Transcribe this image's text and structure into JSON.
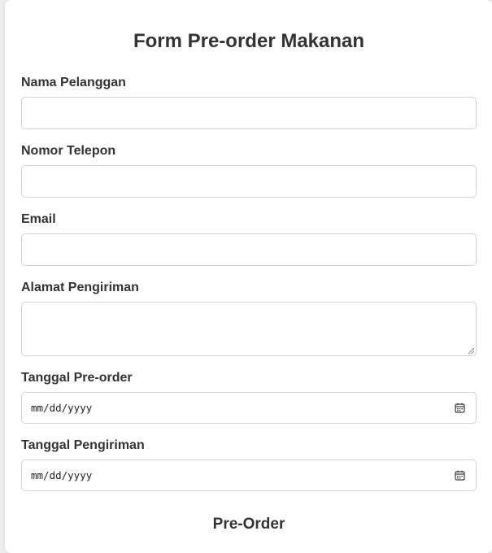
{
  "form": {
    "title": "Form Pre-order Makanan",
    "fields": {
      "nama": {
        "label": "Nama Pelanggan",
        "value": ""
      },
      "telepon": {
        "label": "Nomor Telepon",
        "value": ""
      },
      "email": {
        "label": "Email",
        "value": ""
      },
      "alamat": {
        "label": "Alamat Pengiriman",
        "value": ""
      },
      "tanggal_preorder": {
        "label": "Tanggal Pre-order",
        "value": "mm/dd/yyyy",
        "icon": "calendar-icon"
      },
      "tanggal_pengiriman": {
        "label": "Tanggal Pengiriman",
        "value": "mm/dd/yyyy",
        "icon": "calendar-icon"
      }
    },
    "submit_label": "Pre-Order"
  },
  "colors": {
    "page_background": "#efefef",
    "card_background": "#ffffff",
    "text": "#333333",
    "field_border": "#d4d4d4"
  }
}
